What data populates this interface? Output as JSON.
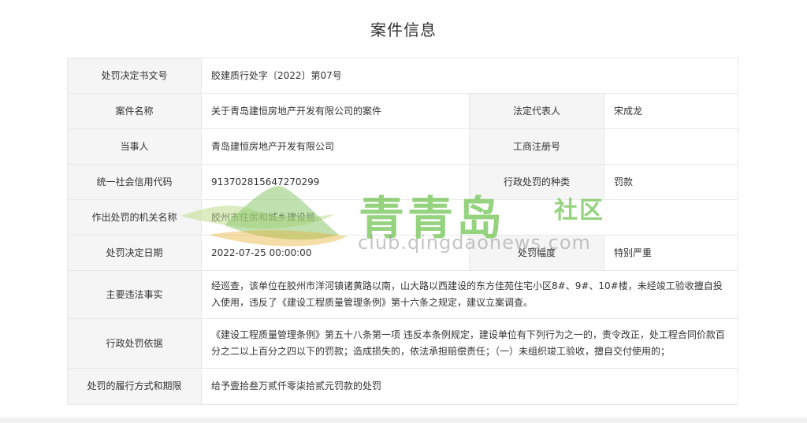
{
  "page": {
    "title": "案件信息"
  },
  "case": {
    "decision_no_label": "处罚决定书文号",
    "decision_no": "胶建质行处字〔2022〕第07号",
    "case_name_label": "案件名称",
    "case_name": "关于青岛建恒房地产开发有限公司的案件",
    "legal_rep_label": "法定代表人",
    "legal_rep": "宋成龙",
    "party_label": "当事人",
    "party": "青岛建恒房地产开发有限公司",
    "biz_reg_label": "工商注册号",
    "biz_reg": "",
    "credit_code_label": "统一社会信用代码",
    "credit_code": "913702815647270299",
    "penalty_type_label": "行政处罚的种类",
    "penalty_type": "罚款",
    "authority_label": "作出处罚的机关名称",
    "authority": "胶州市住房和城乡建设局",
    "decision_date_label": "处罚决定日期",
    "decision_date": "2022-07-25 00:00:00",
    "penalty_range_label": "处罚幅度",
    "penalty_range": "特别严重",
    "facts_label": "主要违法事实",
    "facts": "经巡查，该单位在胶州市洋河镇诸黄路以南，山大路以西建设的东方佳苑住宅小区8#、9#、10#楼，未经竣工验收擅自投入使用，违反了《建设工程质量管理条例》第十六条之规定，建议立案调查。",
    "basis_label": "行政处罚依据",
    "basis": "《建设工程质量管理条例》第五十八条第一项 违反本条例规定，建设单位有下列行为之一的，责令改正，处工程合同价款百分之二以上百分之四以下的罚款；造成损失的，依法承担赔偿责任；（一）未组织竣工验收，擅自交付使用的；",
    "execution_label": "处罚的履行方式和期限",
    "execution": "给予壹拾叁万贰仟零柒拾贰元罚款的处罚"
  },
  "watermark": {
    "name": "青青岛",
    "suffix": "社区",
    "url": "club.qingdaonews.com",
    "color": "#72c454"
  }
}
